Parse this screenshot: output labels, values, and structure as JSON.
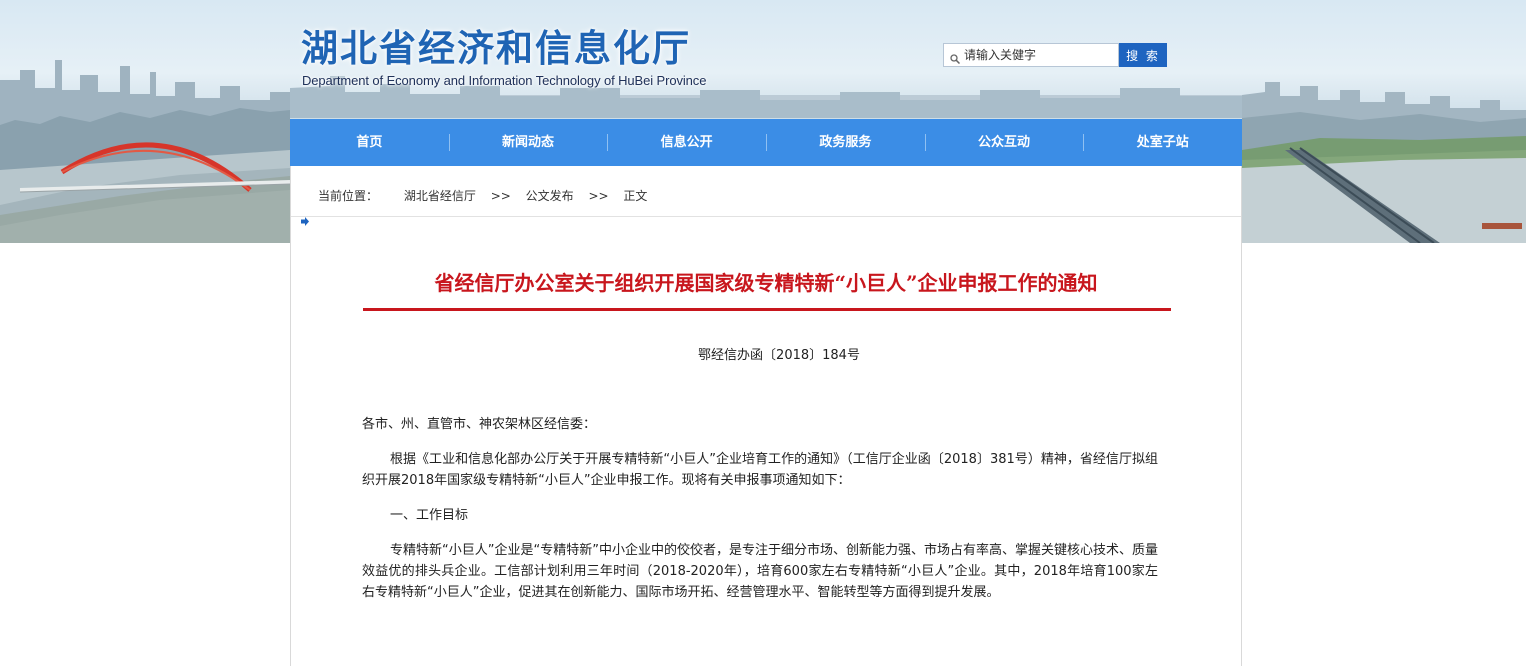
{
  "header": {
    "title_cn": "湖北省经济和信息化厅",
    "title_en": "Department of Economy and Information Technology of HuBei Province",
    "search": {
      "placeholder": "请输入关健字",
      "button_label": "搜 索",
      "icon": "search-icon"
    }
  },
  "nav": {
    "items": [
      {
        "label": "首页"
      },
      {
        "label": "新闻动态"
      },
      {
        "label": "信息公开"
      },
      {
        "label": "政务服务"
      },
      {
        "label": "公众互动"
      },
      {
        "label": "处室子站"
      }
    ]
  },
  "breadcrumb": {
    "label": "当前位置：",
    "items": [
      "湖北省经信厅",
      "公文发布",
      "正文"
    ],
    "separator": ">>",
    "icon": "arrow-right-icon"
  },
  "article": {
    "title": "省经信厅办公室关于组织开展国家级专精特新“小巨人”企业申报工作的通知",
    "doc_number": "鄂经信办函〔2018〕184号",
    "salutation": "各市、州、直管市、神农架林区经信委：",
    "paragraphs": [
      "根据《工业和信息化部办公厅关于开展专精特新“小巨人”企业培育工作的通知》（工信厅企业函〔2018〕381号）精神，省经信厅拟组织开展2018年国家级专精特新“小巨人”企业申报工作。现将有关申报事项通知如下：",
      "一、工作目标",
      "专精特新“小巨人”企业是“专精特新”中小企业中的佼佼者，是专注于细分市场、创新能力强、市场占有率高、掌握关键核心技术、质量效益优的排头兵企业。工信部计划利用三年时间（2018-2020年），培育600家左右专精特新“小巨人”企业。其中，2018年培育100家左右专精特新“小巨人”企业，促进其在创新能力、国际市场开拓、经营管理水平、智能转型等方面得到提升发展。"
    ]
  },
  "colors": {
    "brand_blue": "#1f64b4",
    "nav_blue": "#3b8de6",
    "search_button": "#1e64c0",
    "title_red": "#c8161d"
  }
}
